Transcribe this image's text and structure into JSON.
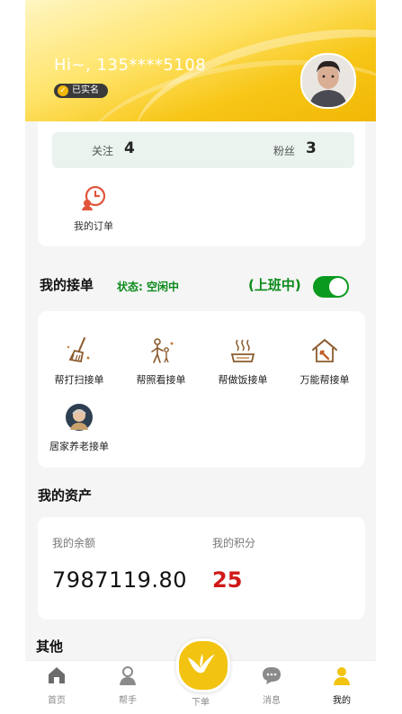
{
  "header": {
    "greeting": "Hi~, 135****5108",
    "verified_badge": "已实名"
  },
  "stats": {
    "following_label": "关注",
    "following_value": "4",
    "followers_label": "粉丝",
    "followers_value": "3"
  },
  "my_order": {
    "label": "我的订单",
    "icon": "order-clock-icon"
  },
  "orders_section": {
    "title": "我的接单",
    "status": "状态: 空闲中",
    "shift": "(上班中)",
    "toggle_on": true
  },
  "services": [
    {
      "label": "帮打扫接单",
      "icon": "broom-icon"
    },
    {
      "label": "帮照看接单",
      "icon": "caregiver-icon"
    },
    {
      "label": "帮做饭接单",
      "icon": "cooking-icon"
    },
    {
      "label": "万能帮接单",
      "icon": "house-hammer-icon"
    },
    {
      "label": "居家养老接单",
      "icon": "elderly-avatar-icon"
    }
  ],
  "assets": {
    "title": "我的资产",
    "balance_label": "我的余额",
    "balance_value": "7987119.80",
    "points_label": "我的积分",
    "points_value": "25"
  },
  "other": {
    "title": "其他"
  },
  "tabbar": {
    "items": [
      {
        "label": "首页",
        "icon": "home-icon"
      },
      {
        "label": "帮手",
        "icon": "helper-icon"
      },
      {
        "label": "下单",
        "icon": "bird-logo-icon"
      },
      {
        "label": "消息",
        "icon": "chat-icon"
      },
      {
        "label": "我的",
        "icon": "profile-icon"
      }
    ],
    "active_index": 4
  },
  "colors": {
    "brand_yellow": "#f2c311",
    "status_green": "#0a8a1a",
    "points_red": "#d01818"
  }
}
